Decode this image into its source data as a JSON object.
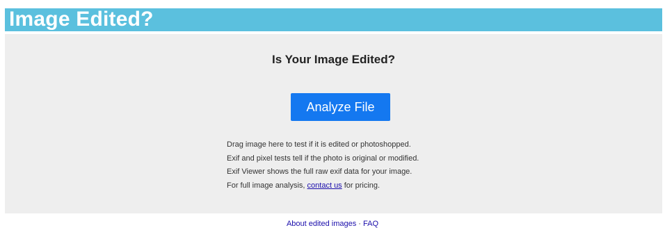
{
  "header": {
    "title": "Image Edited?",
    "background_color": "#5bc0de"
  },
  "main": {
    "title": "Is Your Image Edited?",
    "analyze_button_label": "Analyze File",
    "button_color": "#1478f0",
    "description": {
      "line1": "Drag image here to test if it is edited or photoshopped.",
      "line2": "Exif and pixel tests tell if the photo is original or modified.",
      "line3": "Exif Viewer shows the full raw exif data for your image.",
      "line4_prefix": "For full image analysis, ",
      "contact_link": "contact us",
      "line4_suffix": " for pricing."
    }
  },
  "footer": {
    "link_about": "About edited images",
    "separator": " · ",
    "link_faq": "FAQ"
  }
}
